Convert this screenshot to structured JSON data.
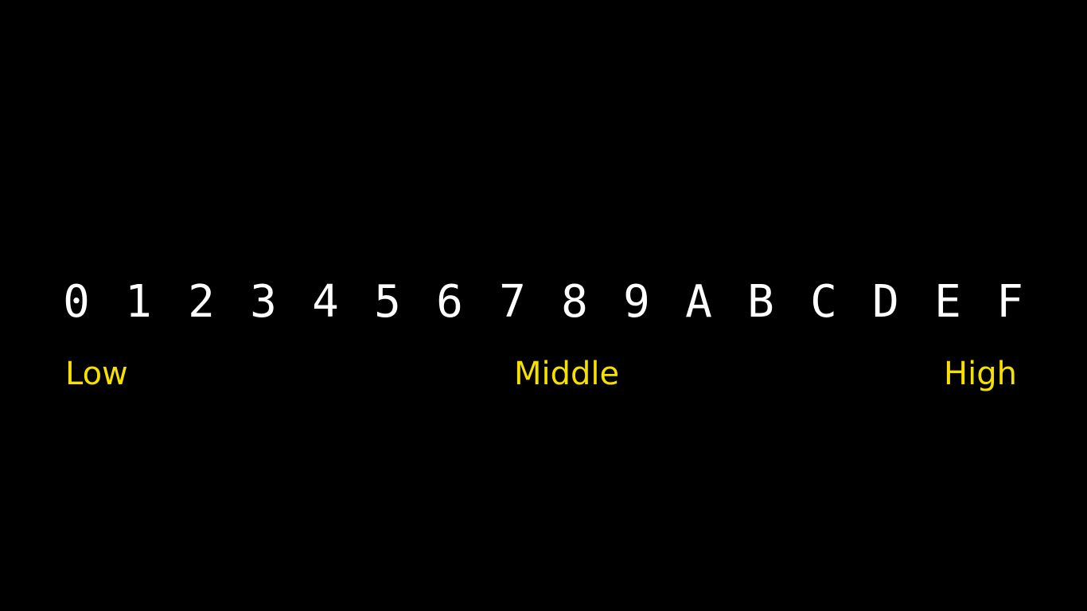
{
  "digits": [
    "0",
    "1",
    "2",
    "3",
    "4",
    "5",
    "6",
    "7",
    "8",
    "9",
    "A",
    "B",
    "C",
    "D",
    "E",
    "F"
  ],
  "labels": {
    "low": "Low",
    "middle": "Middle",
    "high": "High"
  },
  "colors": {
    "background": "#000000",
    "digit": "#ffffff",
    "label": "#f5e000"
  }
}
